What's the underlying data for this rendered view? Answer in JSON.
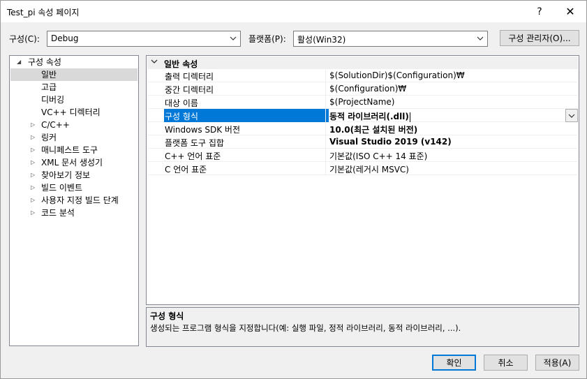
{
  "window": {
    "title": "Test_pi 속성 페이지",
    "help_glyph": "?",
    "close_glyph": "✕"
  },
  "toolbar": {
    "config_label": "구성(C):",
    "config_value": "Debug",
    "platform_label": "플랫폼(P):",
    "platform_value": "활성(Win32)",
    "config_manager_label": "구성 관리자(O)..."
  },
  "tree": {
    "root": {
      "label": "구성 속성",
      "expanded": true
    },
    "children": [
      {
        "label": "일반",
        "selected": true,
        "expandable": false
      },
      {
        "label": "고급",
        "selected": false,
        "expandable": false
      },
      {
        "label": "디버깅",
        "selected": false,
        "expandable": false
      },
      {
        "label": "VC++ 디렉터리",
        "selected": false,
        "expandable": false
      },
      {
        "label": "C/C++",
        "selected": false,
        "expandable": true
      },
      {
        "label": "링커",
        "selected": false,
        "expandable": true
      },
      {
        "label": "매니페스트 도구",
        "selected": false,
        "expandable": true
      },
      {
        "label": "XML 문서 생성기",
        "selected": false,
        "expandable": true
      },
      {
        "label": "찾아보기 정보",
        "selected": false,
        "expandable": true
      },
      {
        "label": "빌드 이벤트",
        "selected": false,
        "expandable": true
      },
      {
        "label": "사용자 지정 빌드 단계",
        "selected": false,
        "expandable": true
      },
      {
        "label": "코드 분석",
        "selected": false,
        "expandable": true
      }
    ]
  },
  "grid": {
    "category": "일반 속성",
    "properties": [
      {
        "name": "출력 디렉터리",
        "value": "$(SolutionDir)$(Configuration)₩",
        "bold": false,
        "selected": false
      },
      {
        "name": "중간 디렉터리",
        "value": "$(Configuration)₩",
        "bold": false,
        "selected": false
      },
      {
        "name": "대상 이름",
        "value": "$(ProjectName)",
        "bold": false,
        "selected": false
      },
      {
        "name": "구성 형식",
        "value": "동적 라이브러리(.dll)",
        "bold": true,
        "selected": true
      },
      {
        "name": "Windows SDK 버전",
        "value": "10.0(최근 설치된 버전)",
        "bold": true,
        "selected": false
      },
      {
        "name": "플랫폼 도구 집합",
        "value": "Visual Studio 2019 (v142)",
        "bold": true,
        "selected": false
      },
      {
        "name": "C++ 언어 표준",
        "value": "기본값(ISO C++ 14 표준)",
        "bold": false,
        "selected": false
      },
      {
        "name": "C 언어 표준",
        "value": "기본값(레거시 MSVC)",
        "bold": false,
        "selected": false
      }
    ]
  },
  "description": {
    "title": "구성 형식",
    "text": "생성되는 프로그램 형식을 지정합니다(예: 실행 파일, 정적 라이브러리, 동적 라이브러리, ...)."
  },
  "buttons": {
    "ok": "확인",
    "cancel": "취소",
    "apply": "적용(A)"
  },
  "colors": {
    "selection": "#0078d7",
    "tree_selection": "#d9d9d9"
  }
}
